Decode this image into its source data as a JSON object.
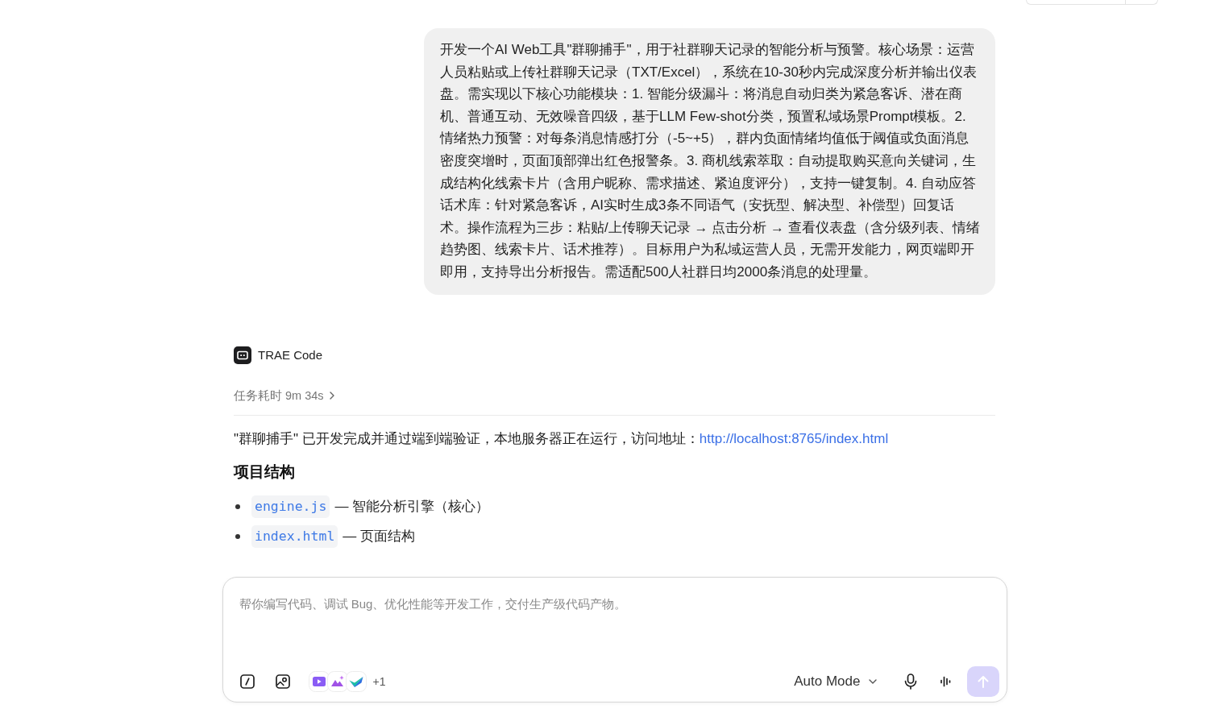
{
  "user_message": {
    "text": "开发一个AI Web工具\"群聊捕手\"，用于社群聊天记录的智能分析与预警。核心场景：运营人员粘贴或上传社群聊天记录（TXT/Excel），系统在10-30秒内完成深度分析并输出仪表盘。需实现以下核心功能模块：1. 智能分级漏斗：将消息自动归类为紧急客诉、潜在商机、普通互动、无效噪音四级，基于LLM Few-shot分类，预置私域场景Prompt模板。2. 情绪热力预警：对每条消息情感打分（-5~+5），群内负面情绪均值低于阈值或负面消息密度突增时，页面顶部弹出红色报警条。3. 商机线索萃取：自动提取购买意向关键词，生成结构化线索卡片（含用户昵称、需求描述、紧迫度评分），支持一键复制。4. 自动应答话术库：针对紧急客诉，AI实时生成3条不同语气（安抚型、解决型、补偿型）回复话术。操作流程为三步：粘贴/上传聊天记录 → 点击分析 → 查看仪表盘（含分级列表、情绪趋势图、线索卡片、话术推荐）。目标用户为私域运营人员，无需开发能力，网页端即开即用，支持导出分析报告。需适配500人社群日均2000条消息的处理量。"
  },
  "assistant": {
    "name": "TRAE Code",
    "duration": "任务耗时 9m 34s",
    "summary": {
      "text": "\"群聊捕手\" 已开发完成并通过端到端验证，本地服务器正在运行，访问地址：",
      "link": "http://localhost:8765/index.html"
    },
    "section_heading": "项目结构",
    "files": [
      {
        "name": "engine.js",
        "description": "— 智能分析引擎（核心）"
      },
      {
        "name": "index.html",
        "description": "— 页面结构"
      }
    ]
  },
  "composer": {
    "placeholder": "帮你编写代码、调试 Bug、优化性能等开发工作，交付生产级代码产物。",
    "extension_count": "+1",
    "mode": "Auto Mode"
  }
}
